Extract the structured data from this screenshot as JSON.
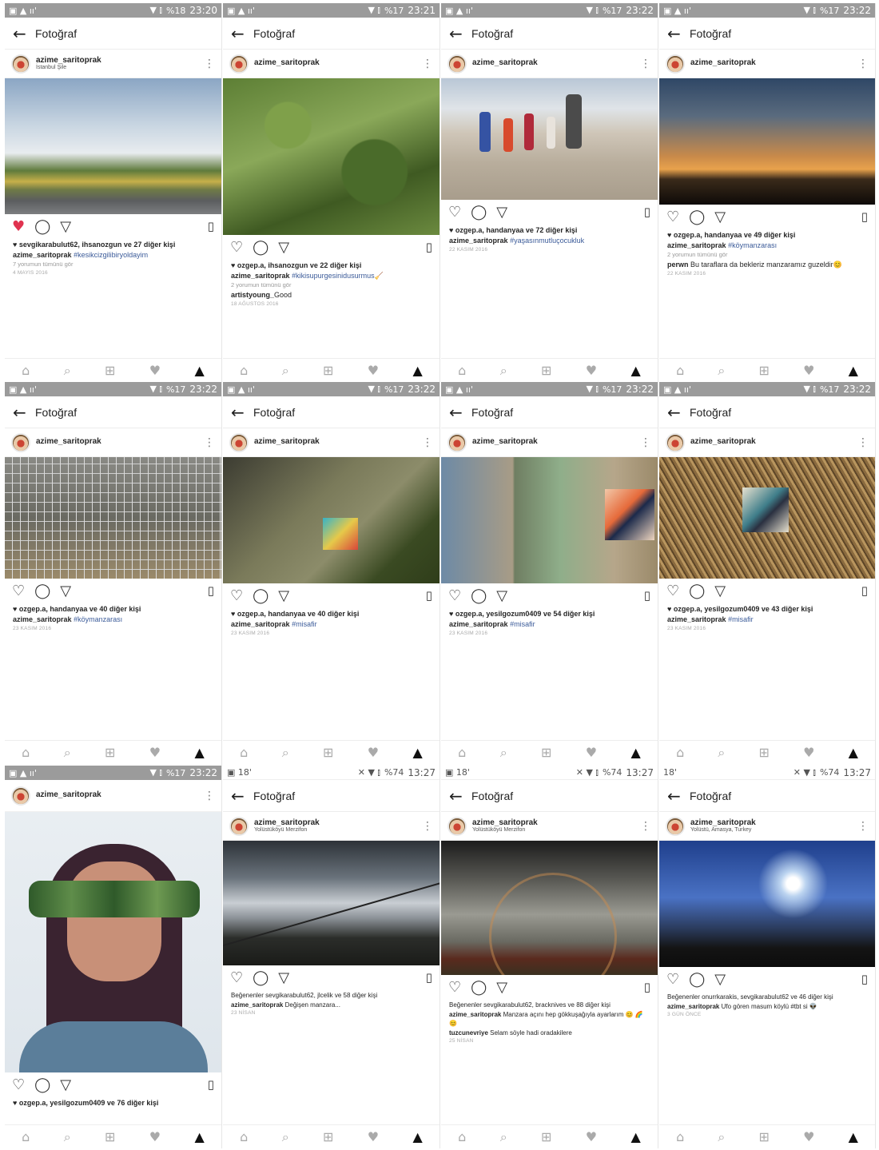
{
  "status": {
    "time_a": "23:20",
    "time_b": "23:21",
    "time_c": "23:22",
    "time_d": "13:27",
    "bat_a": "%18",
    "bat_b": "%17",
    "bat_c": "%74",
    "sig": "☰"
  },
  "header_title": "Fotoğraf",
  "user": "azime_saritoprak",
  "nav": [
    "⌂",
    "⌕",
    "⊞",
    "♥",
    "▲"
  ],
  "posts": [
    {
      "loc": "İstanbul Şile",
      "likes": "sevgikarabulut62, ihsanozgun ve 27 diğer kişi",
      "cap_user": "azime_saritoprak",
      "cap_text": "#kesikcizgilibiryoldayim",
      "comments": "7 yorumun tümünü gör",
      "date": "4 MAYIS 2016",
      "liked": true
    },
    {
      "likes": "ozgep.a, ihsanozgun ve 22 diğer kişi",
      "cap_user": "azime_saritoprak",
      "cap_text": "#kikisupurgesinidusurmus🧹",
      "comments": "2 yorumun tümünü gör",
      "comment_user": "artistyoung_",
      "comment_text": "Good",
      "date": "18 AĞUSTOS 2016"
    },
    {
      "likes": "ozgep.a, handanyaa ve 72 diğer kişi",
      "cap_user": "azime_saritoprak",
      "cap_text": "#yaşasınmutluçocukluk",
      "date": "22 KASIM 2016"
    },
    {
      "likes": "ozgep.a, handanyaa ve 49 diğer kişi",
      "cap_user": "azime_saritoprak",
      "cap_text": "#köymanzarası",
      "comments": "2 yorumun tümünü gör",
      "comment_user": "perwn",
      "comment_text": "Bu taraflara da bekleriz manzaramız guzeldir😊",
      "date": "22 KASIM 2016"
    },
    {
      "likes": "ozgep.a, handanyaa ve 40 diğer kişi",
      "cap_user": "azime_saritoprak",
      "cap_text": "#köymanzarası",
      "date": "23 KASIM 2016"
    },
    {
      "likes": "ozgep.a, handanyaa ve 40 diğer kişi",
      "cap_user": "azime_saritoprak",
      "cap_text": "#misafir",
      "date": "23 KASIM 2016"
    },
    {
      "likes": "ozgep.a, yesilgozum0409 ve 54 diğer kişi",
      "cap_user": "azime_saritoprak",
      "cap_text": "#misafir",
      "date": "23 KASIM 2016"
    },
    {
      "likes": "ozgep.a, yesilgozum0409 ve 43 diğer kişi",
      "cap_user": "azime_saritoprak",
      "cap_text": "#misafir",
      "date": "23 KASIM 2016"
    },
    {
      "likes": "ozgep.a, yesilgozum0409 ve 76 diğer kişi"
    },
    {
      "loc": "Yolüstüköyü Merzifon",
      "likes": "Beğenenler sevgikarabulut62, jlcelik ve 58 diğer kişi",
      "cap_user": "azime_saritoprak",
      "cap_text": "Değişen manzara...",
      "date": "23 NİSAN"
    },
    {
      "loc": "Yolüstüköyü Merzifon",
      "likes": "Beğenenler sevgikarabulut62, bracknives ve 88 diğer kişi",
      "cap_user": "azime_saritoprak",
      "cap_text": "Manzara açını hep gökkuşağıyla ayarlarım 😊 🌈😊",
      "comment_user": "tuzcunevriye",
      "comment_text": "Selam söyle hadi oradakilere",
      "date": "25 NİSAN"
    },
    {
      "loc": "Yolüstü, Amasya, Turkey",
      "likes": "Beğenenler onurrkarakis, sevgikarabulut62 ve 46 diğer kişi",
      "cap_user": "azime_saritoprak",
      "cap_text": "Ufo gören masum köylü #tbt si 👽",
      "date": "3 GÜN ÖNCE"
    }
  ]
}
